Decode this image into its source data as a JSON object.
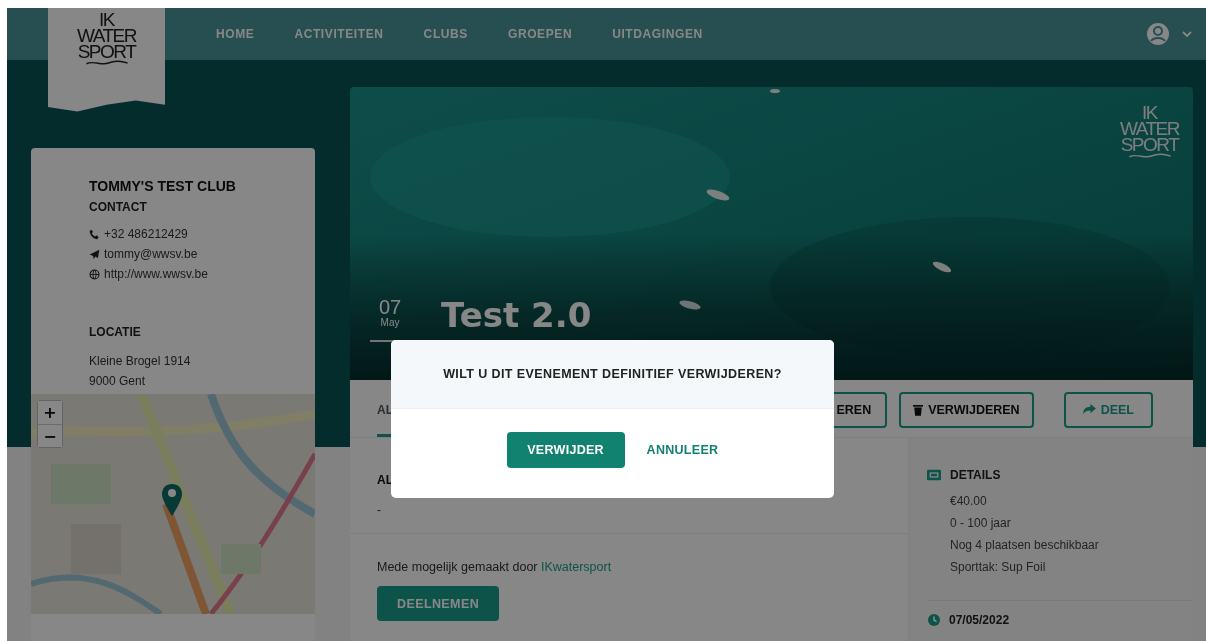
{
  "nav": {
    "logo": [
      "IK",
      "WATER",
      "SPORT"
    ],
    "items": [
      {
        "label": "HOME"
      },
      {
        "label": "ACTIVITEITEN"
      },
      {
        "label": "CLUBS"
      },
      {
        "label": "GROEPEN"
      },
      {
        "label": "UITDAGINGEN"
      }
    ]
  },
  "club": {
    "name": "TOMMY'S TEST CLUB",
    "contact_heading": "CONTACT",
    "contacts": [
      {
        "kind": "phone",
        "text": "+32 486212429"
      },
      {
        "kind": "email",
        "text": "tommy@wwsv.be"
      },
      {
        "kind": "web",
        "text": "http://www.wwsv.be"
      }
    ],
    "location_heading": "LOCATIE",
    "address": [
      "Kleine Brogel 1914",
      "9000 Gent"
    ],
    "map": {
      "kind": "picture",
      "zoom_in": "+",
      "zoom_out": "−"
    }
  },
  "event": {
    "day": "07",
    "month": "May",
    "title": "Test 2.0",
    "hero_logo": [
      "IK",
      "WATER",
      "SPORT"
    ],
    "tabs": [
      {
        "label": "AL",
        "selected": true
      }
    ],
    "actions": [
      {
        "kind": "plain",
        "label": "EREN"
      },
      {
        "kind": "delete",
        "label": "VERWIJDEREN"
      },
      {
        "kind": "share",
        "label": "DEEL"
      }
    ],
    "section_heading": "AL",
    "section_text": "-",
    "credit": {
      "text": "Mede mogelijk gemaakt door",
      "link": "IKwatersport"
    },
    "join_button": "DEELNEMEN",
    "details": {
      "heading": "DETAILS",
      "lines": [
        "€40.00",
        "0 - 100 jaar",
        "Nog 4 plaatsen beschikbaar",
        "Sporttak: Sup Foil"
      ]
    },
    "date": "07/05/2022"
  },
  "dialog": {
    "title": "WILT U DIT EVENEMENT DEFINITIEF VERWIJDEREN?",
    "confirm": "VERWIJDER",
    "cancel": "ANNULEER"
  }
}
